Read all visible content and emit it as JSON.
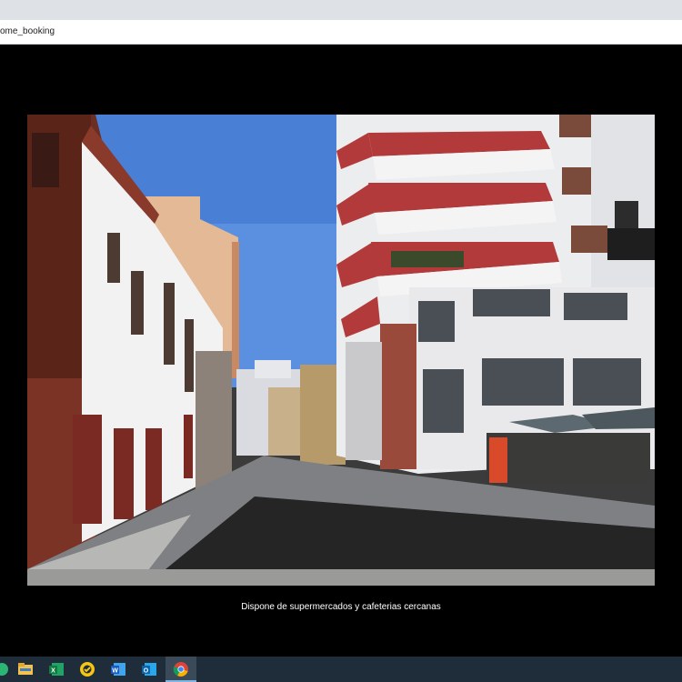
{
  "browser": {
    "address": "ome_booking"
  },
  "viewer": {
    "caption": "Dispone de supermercados y cafeterias cercanas"
  },
  "taskbar": {
    "icons": [
      "edge-icon",
      "file-explorer-icon",
      "excel-icon",
      "norton-icon",
      "word-icon",
      "outlook-icon",
      "chrome-icon"
    ]
  }
}
